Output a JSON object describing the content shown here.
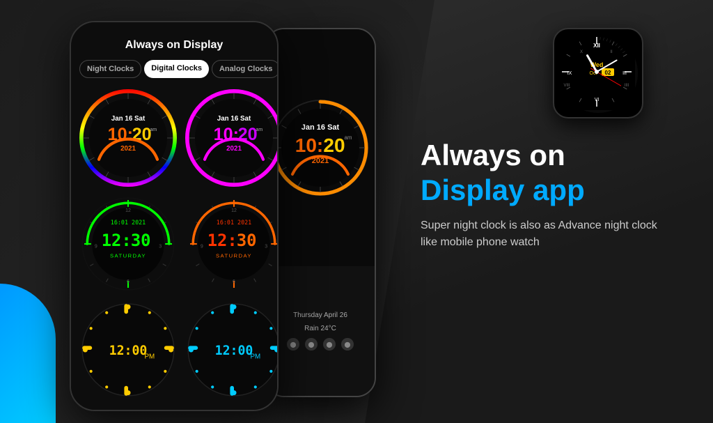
{
  "app": {
    "background_color": "#1a1a1a"
  },
  "phone_screen": {
    "title": "Always on Display",
    "tabs": [
      {
        "id": "night",
        "label": "Night Clocks",
        "active": false
      },
      {
        "id": "digital",
        "label": "Digital Clocks",
        "active": true
      },
      {
        "id": "analog",
        "label": "Analog Clocks",
        "active": false
      }
    ]
  },
  "clocks": [
    {
      "id": "clock1",
      "date": "Jan 16 Sat",
      "time": "10:20",
      "ampm": "am",
      "year": "2021",
      "ring_color": "rainbow"
    },
    {
      "id": "clock2",
      "date": "Jan 16 Sat",
      "time": "10:20",
      "ampm": "am",
      "year": "2021",
      "ring_color": "magenta"
    },
    {
      "id": "clock3",
      "date": "16:01 2021",
      "time": "12:30",
      "day": "SATURDAY",
      "ring_color": "green"
    },
    {
      "id": "clock4",
      "date": "16:01 2021",
      "time": "12:30",
      "day": "SATURDAY",
      "ring_color": "orange"
    },
    {
      "id": "clock5",
      "time": "12:00",
      "ampm": "PM",
      "ring_color": "yellow-dots"
    },
    {
      "id": "clock6",
      "time": "12:00",
      "ampm": "PM",
      "ring_color": "blue-dots"
    }
  ],
  "large_phone": {
    "clock": {
      "date": "Jan 16 Sat",
      "time_h": "10:",
      "time_m": "20",
      "ampm": "am",
      "year": "2021"
    },
    "weather": {
      "line1": "Thursday April 26",
      "line2": "Rain 24°C"
    }
  },
  "analog_watch": {
    "day": "Wed",
    "month": "Oct",
    "date": "02"
  },
  "right_text": {
    "heading_white": "Always on",
    "heading_blue": "Display app",
    "description": "Super night clock is also as Advance night clock like mobile phone watch"
  }
}
